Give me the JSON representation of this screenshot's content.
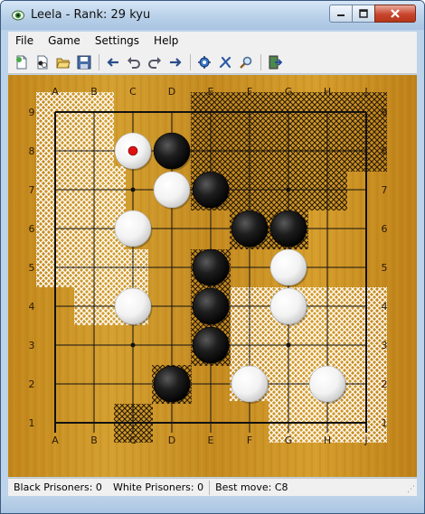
{
  "window": {
    "title": "Leela - Rank: 29 kyu"
  },
  "menu": {
    "items": [
      "File",
      "Game",
      "Settings",
      "Help"
    ]
  },
  "toolbar": {
    "buttons": [
      "new-game-icon",
      "new-handicap-game-icon",
      "open-file-icon",
      "save-file-icon",
      "back-arrow-icon",
      "undo-icon",
      "redo-icon",
      "forward-arrow-icon",
      "settings-icon",
      "resign-icon",
      "analyze-icon",
      "exit-icon"
    ]
  },
  "board": {
    "size": 9,
    "columns": [
      "A",
      "B",
      "C",
      "D",
      "E",
      "F",
      "G",
      "H",
      "J"
    ],
    "rows": [
      "9",
      "8",
      "7",
      "6",
      "5",
      "4",
      "3",
      "2",
      "1"
    ],
    "stones": [
      {
        "color": "white",
        "point": "C8",
        "last_move": true
      },
      {
        "color": "black",
        "point": "D8"
      },
      {
        "color": "white",
        "point": "D7"
      },
      {
        "color": "black",
        "point": "E7"
      },
      {
        "color": "white",
        "point": "C6"
      },
      {
        "color": "black",
        "point": "F6"
      },
      {
        "color": "black",
        "point": "G6"
      },
      {
        "color": "black",
        "point": "E5"
      },
      {
        "color": "white",
        "point": "G5"
      },
      {
        "color": "white",
        "point": "C4"
      },
      {
        "color": "black",
        "point": "E4"
      },
      {
        "color": "white",
        "point": "G4"
      },
      {
        "color": "black",
        "point": "E3"
      },
      {
        "color": "black",
        "point": "D2"
      },
      {
        "color": "white",
        "point": "F2"
      },
      {
        "color": "white",
        "point": "H2"
      }
    ],
    "colors": {
      "wood": "#c8901c",
      "black_territory": "#2a1a08",
      "white_territory": "#ffffff",
      "last_move_marker": "#e01010"
    }
  },
  "status": {
    "black_prisoners": "Black Prisoners: 0",
    "white_prisoners": "White Prisoners: 0",
    "best_move": "Best move: C8"
  }
}
